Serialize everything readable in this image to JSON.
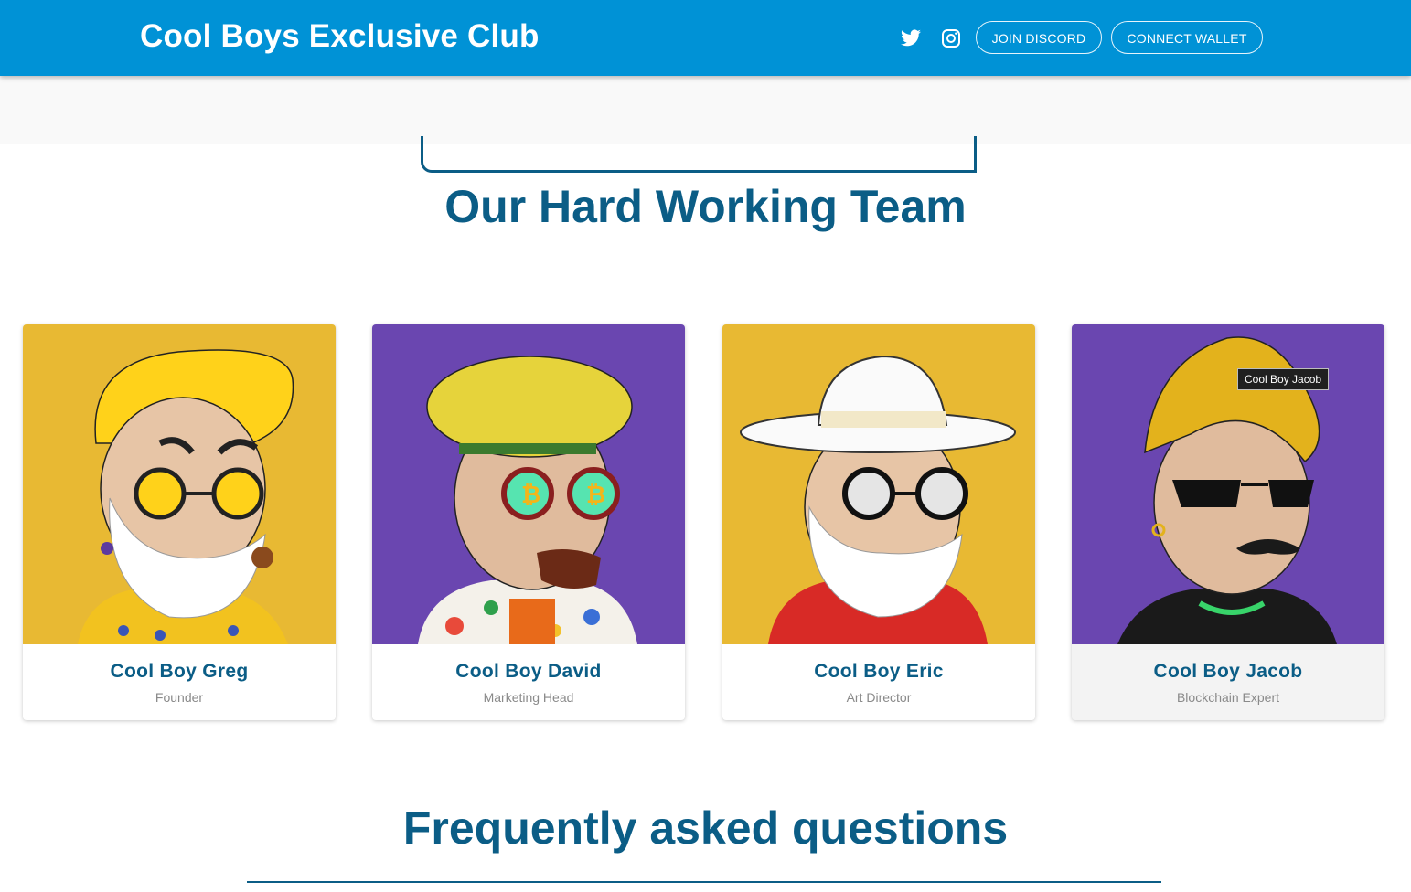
{
  "header": {
    "brand": "Cool Boys Exclusive Club",
    "discord_label": "JOIN DISCORD",
    "wallet_label": "CONNECT WALLET",
    "icons": [
      "twitter-icon",
      "instagram-icon"
    ]
  },
  "team": {
    "title": "Our Hard Working Team",
    "members": [
      {
        "name": "Cool Boy Greg",
        "role": "Founder",
        "bg": "#e8b933"
      },
      {
        "name": "Cool Boy David",
        "role": "Marketing Head",
        "bg": "#6a46b0"
      },
      {
        "name": "Cool Boy Eric",
        "role": "Art Director",
        "bg": "#e8b933"
      },
      {
        "name": "Cool Boy Jacob",
        "role": "Blockchain Expert",
        "bg": "#6a46b0"
      }
    ],
    "tooltip": "Cool Boy Jacob"
  },
  "faq": {
    "title": "Frequently asked questions"
  },
  "colors": {
    "appbar": "#0092d6",
    "accent": "#0b5d86",
    "yellow_bg": "#e8b933",
    "purple_bg": "#6a46b0"
  }
}
